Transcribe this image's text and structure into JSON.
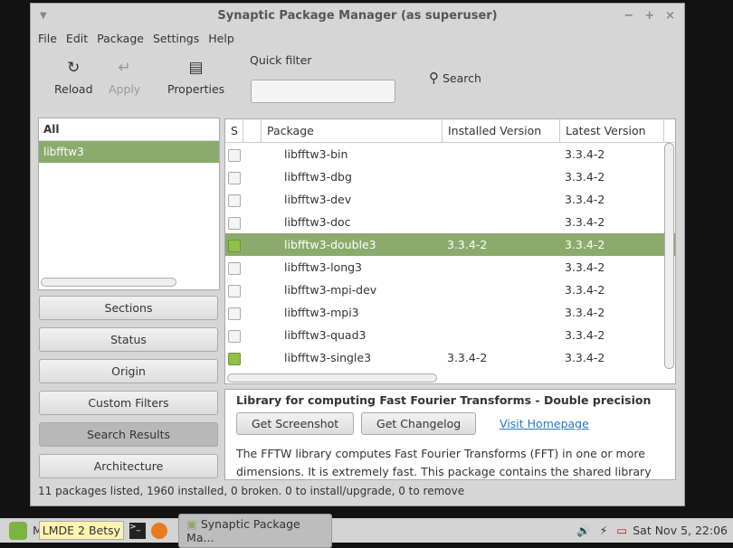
{
  "window": {
    "title": "Synaptic Package Manager  (as superuser)"
  },
  "menu": [
    "File",
    "Edit",
    "Package",
    "Settings",
    "Help"
  ],
  "toolbar": {
    "reload": "Reload",
    "apply": "Apply",
    "properties": "Properties",
    "quick_filter_label": "Quick filter",
    "quick_filter_value": "",
    "search": "Search"
  },
  "left": {
    "header": "All",
    "items": [
      "libfftw3"
    ]
  },
  "filters": [
    "Sections",
    "Status",
    "Origin",
    "Custom Filters",
    "Search Results",
    "Architecture"
  ],
  "table": {
    "columns": [
      "S",
      "",
      "Package",
      "Installed Version",
      "Latest Version"
    ],
    "rows": [
      {
        "name": "libfftw3-bin",
        "installed": "",
        "latest": "3.3.4-2",
        "checked": false
      },
      {
        "name": "libfftw3-dbg",
        "installed": "",
        "latest": "3.3.4-2",
        "checked": false
      },
      {
        "name": "libfftw3-dev",
        "installed": "",
        "latest": "3.3.4-2",
        "checked": false
      },
      {
        "name": "libfftw3-doc",
        "installed": "",
        "latest": "3.3.4-2",
        "checked": false
      },
      {
        "name": "libfftw3-double3",
        "installed": "3.3.4-2",
        "latest": "3.3.4-2",
        "checked": true,
        "selected": true
      },
      {
        "name": "libfftw3-long3",
        "installed": "",
        "latest": "3.3.4-2",
        "checked": false
      },
      {
        "name": "libfftw3-mpi-dev",
        "installed": "",
        "latest": "3.3.4-2",
        "checked": false
      },
      {
        "name": "libfftw3-mpi3",
        "installed": "",
        "latest": "3.3.4-2",
        "checked": false
      },
      {
        "name": "libfftw3-quad3",
        "installed": "",
        "latest": "3.3.4-2",
        "checked": false
      },
      {
        "name": "libfftw3-single3",
        "installed": "3.3.4-2",
        "latest": "3.3.4-2",
        "checked": true
      }
    ]
  },
  "desc": {
    "title": "Library for computing Fast Fourier Transforms - Double precision",
    "screenshot": "Get Screenshot",
    "changelog": "Get Changelog",
    "homepage": "Visit Homepage",
    "text": "The FFTW library computes Fast Fourier Transforms (FFT) in one or more dimensions. It is extremely fast. This package contains the shared library"
  },
  "status": "11 packages listed, 1960 installed, 0 broken. 0 to install/upgrade, 0 to remove",
  "taskbar": {
    "menu": "M",
    "tooltip": "LMDE 2 Betsy",
    "task": "Synaptic Package Ma...",
    "clock": "Sat Nov  5, 22:06"
  }
}
